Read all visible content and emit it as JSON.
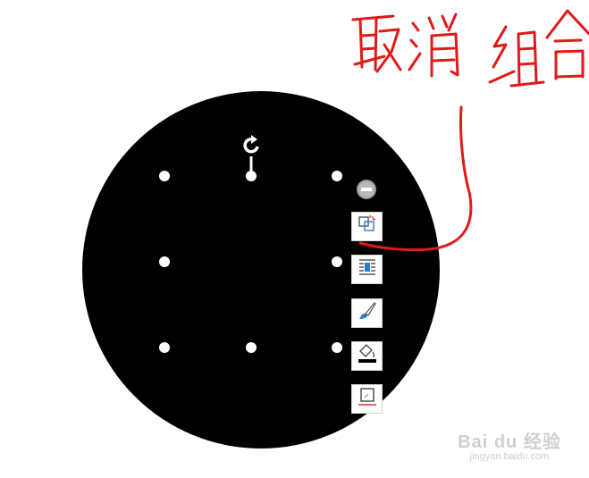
{
  "annotation": {
    "handwriting_text": "取消组合",
    "ink_color": "#e01a1a"
  },
  "shape": {
    "fill": "#000000",
    "handle_color": "#ffffff"
  },
  "toolbar": {
    "collapse": "collapse-icon",
    "buttons": [
      {
        "icon": "ungroup-icon"
      },
      {
        "icon": "wrap-text-icon"
      },
      {
        "icon": "brush-icon"
      },
      {
        "icon": "fill-color-icon"
      },
      {
        "icon": "border-icon"
      }
    ]
  },
  "watermark": {
    "brand": "Bai du 经验",
    "url": "jingyan.baidu.com"
  }
}
